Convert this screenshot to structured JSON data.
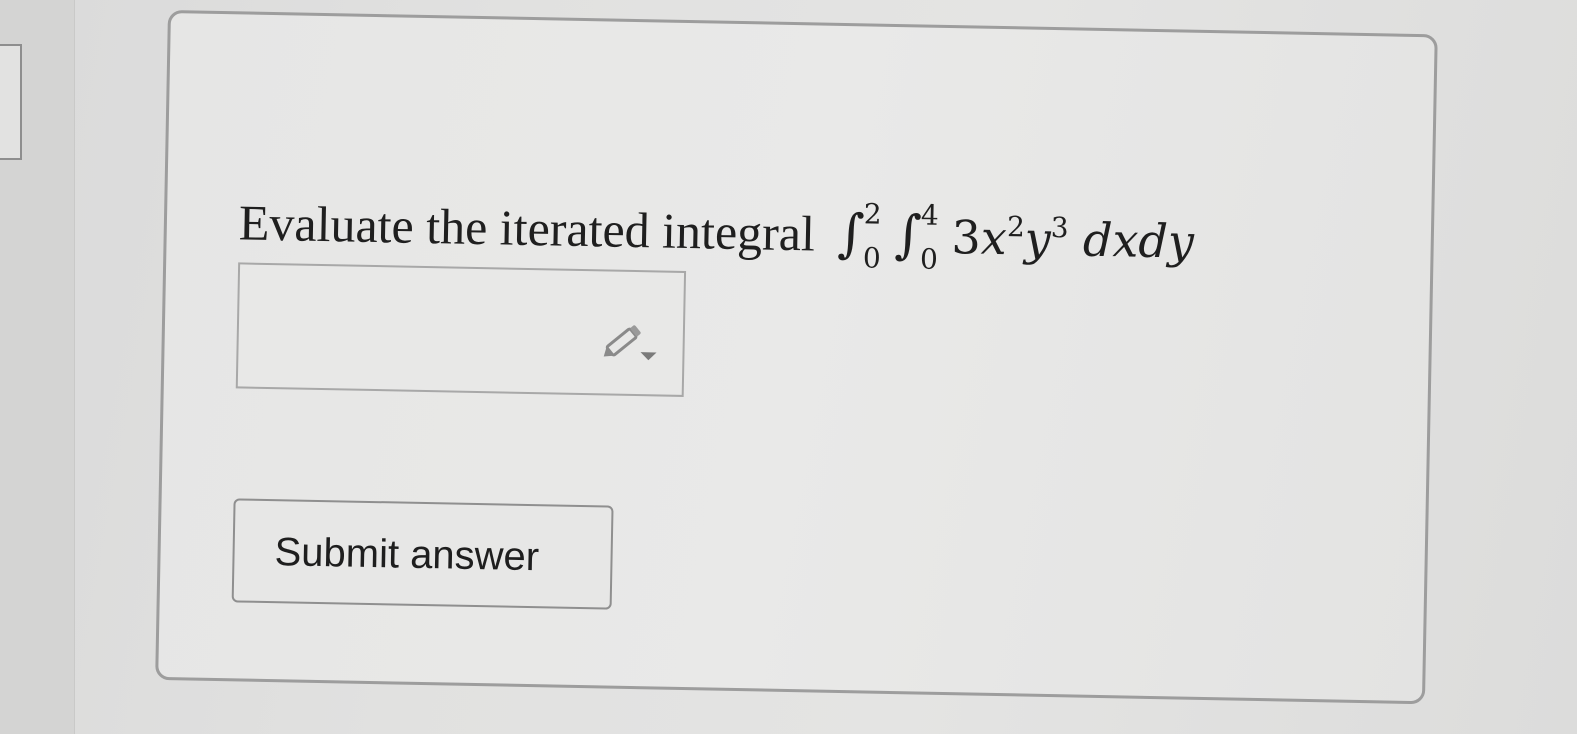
{
  "question": {
    "prompt": "Evaluate the iterated integral",
    "integral_outer": {
      "upper": "2",
      "lower": "0"
    },
    "integral_inner": {
      "upper": "4",
      "lower": "0"
    },
    "integrand": {
      "coef": "3",
      "var1": "x",
      "exp1": "2",
      "var2": "y",
      "exp2": "3",
      "differentials": "dxdy"
    }
  },
  "answer_input": {
    "value": "",
    "icon": "pencil-dropdown-icon"
  },
  "submit": {
    "label": "Submit answer"
  }
}
